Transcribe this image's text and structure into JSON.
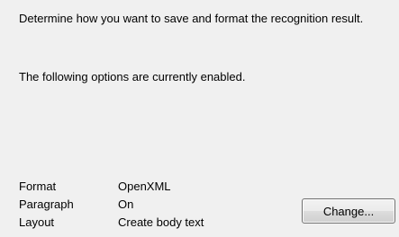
{
  "description": "Determine how you want to save and format the recognition result.",
  "enabled_note": "The following options are currently enabled.",
  "settings": [
    {
      "label": "Format",
      "value": "OpenXML"
    },
    {
      "label": "Paragraph",
      "value": "On"
    },
    {
      "label": "Layout",
      "value": "Create body text"
    }
  ],
  "change_button": "Change..."
}
